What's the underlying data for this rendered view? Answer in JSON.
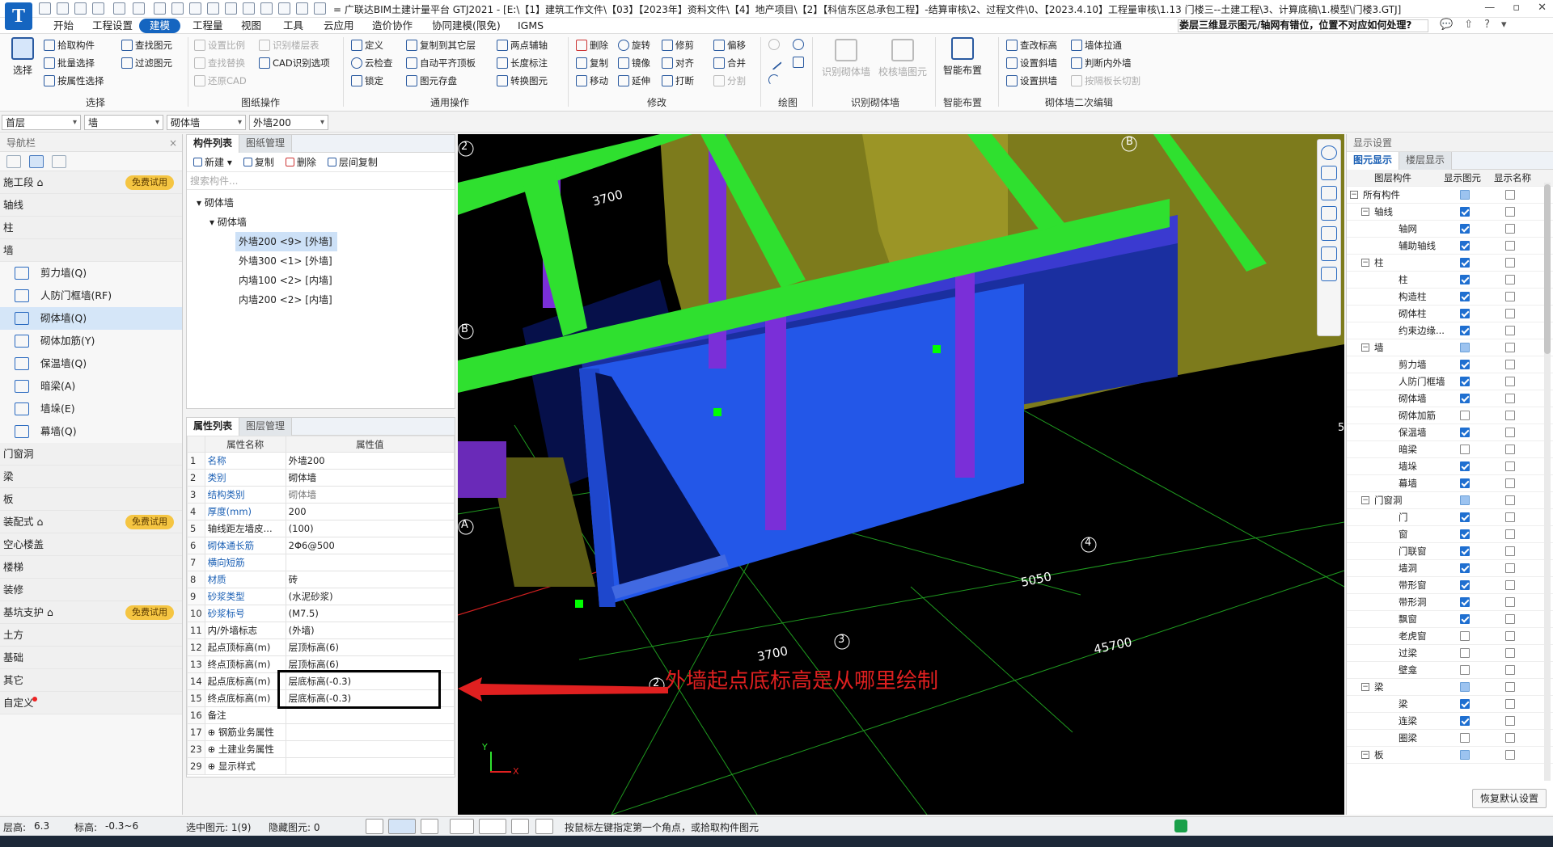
{
  "app": {
    "logo": "T",
    "title": "= 广联达BIM土建计量平台 GTJ2021 - [E:\\【1】建筑工作文件\\【03】【2023年】资料文件\\【4】地产项目\\【2】【科信东区总承包工程】-结算审核\\2、过程文件\\0、【2023.4.10】工程量审核\\1.13 门楼三--土建工程\\3、计算底稿\\1.模型\\门楼3.GTJ]",
    "window_controls": [
      "—",
      "▫",
      "✕"
    ]
  },
  "menu": {
    "items": [
      "开始",
      "工程设置",
      "建模",
      "工程量",
      "视图",
      "工具",
      "云应用",
      "造价协作",
      "协同建模(限免)",
      "IGMS"
    ],
    "active_index": 2,
    "help_question": "娄层三维显示图元/轴网有错位，位置不对应如何处理?",
    "right_icons": [
      "💬",
      "⇧",
      "?",
      "▾"
    ]
  },
  "ribbon": {
    "groups": [
      {
        "label": "选择",
        "big": "选择",
        "items": [
          "拾取构件",
          "批量选择",
          "按属性选择",
          "查找图元",
          "过滤图元"
        ]
      },
      {
        "label": "图纸操作",
        "items": [
          "设置比例",
          "查找替换",
          "还原CAD",
          "识别楼层表",
          "CAD识别选项"
        ]
      },
      {
        "label": "通用操作",
        "items": [
          "定义",
          "云检查",
          "锁定",
          "复制到其它层",
          "自动平齐顶板",
          "图元存盘",
          "两点辅轴",
          "长度标注",
          "转换图元"
        ]
      },
      {
        "label": "修改",
        "items": [
          "删除",
          "复制",
          "移动",
          "旋转",
          "镜像",
          "延伸",
          "修剪",
          "对齐",
          "打断",
          "偏移",
          "合并",
          "分割"
        ]
      },
      {
        "label": "绘图",
        "items": []
      },
      {
        "label": "识别砌体墙",
        "items": [
          "识别砌体墙",
          "校核墙图元"
        ]
      },
      {
        "label": "智能布置",
        "big": "智能布置",
        "items": []
      },
      {
        "label": "砌体墙二次编辑",
        "items": [
          "查改标高",
          "设置斜墙",
          "设置拱墙",
          "墙体拉通",
          "判断内外墙",
          "按隔板长切割"
        ]
      }
    ]
  },
  "selectors": [
    "首层",
    "墙",
    "砌体墙",
    "外墙200"
  ],
  "nav": {
    "title": "导航栏",
    "categories": [
      {
        "label": "施工段 ⌂",
        "badge": "免费试用"
      },
      {
        "label": "轴线"
      },
      {
        "label": "柱"
      },
      {
        "label": "墙"
      }
    ],
    "wall_items": [
      "剪力墙(Q)",
      "人防门框墙(RF)",
      "砌体墙(Q)",
      "砌体加筋(Y)",
      "保温墙(Q)",
      "暗梁(A)",
      "墙垛(E)",
      "幕墙(Q)"
    ],
    "selected_item": "砌体墙(Q)",
    "lower_categories": [
      {
        "label": "门窗洞"
      },
      {
        "label": "梁"
      },
      {
        "label": "板"
      },
      {
        "label": "装配式 ⌂",
        "badge": "免费试用"
      },
      {
        "label": "空心楼盖"
      },
      {
        "label": "楼梯"
      },
      {
        "label": "装修"
      },
      {
        "label": "基坑支护 ⌂",
        "badge": "免费试用"
      },
      {
        "label": "土方"
      },
      {
        "label": "基础"
      },
      {
        "label": "其它"
      },
      {
        "label": "自定义",
        "dot": true
      }
    ]
  },
  "component_list": {
    "tabs": [
      "构件列表",
      "图纸管理"
    ],
    "tools": [
      "新建 ▾",
      "复制",
      "删除",
      "层间复制"
    ],
    "search_placeholder": "搜索构件...",
    "tree": {
      "root": "砌体墙",
      "child": "砌体墙",
      "leaves": [
        "外墙200 <9> [外墙]",
        "外墙300 <1> [外墙]",
        "内墙100 <2> [内墙]",
        "内墙200 <2> [内墙]"
      ],
      "selected": 0
    }
  },
  "property_list": {
    "tabs": [
      "属性列表",
      "图层管理"
    ],
    "headers": [
      "属性名称",
      "属性值"
    ],
    "rows": [
      {
        "n": "1",
        "name": "名称",
        "value": "外墙200",
        "blue": true
      },
      {
        "n": "2",
        "name": "类别",
        "value": "砌体墙",
        "blue": true
      },
      {
        "n": "3",
        "name": "结构类别",
        "value": "砌体墙",
        "blue": true,
        "grey": true
      },
      {
        "n": "4",
        "name": "厚度(mm)",
        "value": "200",
        "blue": true
      },
      {
        "n": "5",
        "name": "轴线距左墙皮...",
        "value": "(100)"
      },
      {
        "n": "6",
        "name": "砌体通长筋",
        "value": "2Φ6@500",
        "blue": true
      },
      {
        "n": "7",
        "name": "横向短筋",
        "value": "",
        "blue": true
      },
      {
        "n": "8",
        "name": "材质",
        "value": "砖",
        "blue": true
      },
      {
        "n": "9",
        "name": "砂浆类型",
        "value": "(水泥砂浆)",
        "blue": true
      },
      {
        "n": "10",
        "name": "砂浆标号",
        "value": "(M7.5)",
        "blue": true
      },
      {
        "n": "11",
        "name": "内/外墙标志",
        "value": "(外墙)"
      },
      {
        "n": "12",
        "name": "起点顶标高(m)",
        "value": "层顶标高(6)"
      },
      {
        "n": "13",
        "name": "终点顶标高(m)",
        "value": "层顶标高(6)"
      },
      {
        "n": "14",
        "name": "起点底标高(m)",
        "value": "层底标高(-0.3)"
      },
      {
        "n": "15",
        "name": "终点底标高(m)",
        "value": "层底标高(-0.3)"
      },
      {
        "n": "16",
        "name": "备注",
        "value": ""
      },
      {
        "n": "17",
        "name": "⊕ 钢筋业务属性",
        "value": ""
      },
      {
        "n": "23",
        "name": "⊕ 土建业务属性",
        "value": ""
      },
      {
        "n": "29",
        "name": "⊕ 显示样式",
        "value": ""
      }
    ]
  },
  "viewport": {
    "annotation": "外墙起点底标高是从哪里绘制",
    "dims": [
      "3700",
      "3700",
      "5050",
      "45700"
    ],
    "axis_labels": [
      "2",
      "B",
      "B",
      "A",
      "2",
      "3",
      "4",
      "5"
    ],
    "axes_xyz": [
      "Y",
      "X"
    ]
  },
  "display": {
    "title": "显示设置",
    "tabs": [
      "图元显示",
      "楼层显示"
    ],
    "headers": [
      "图层构件",
      "显示图元",
      "显示名称"
    ],
    "rows": [
      {
        "label": "所有构件",
        "level": 0,
        "show": "part",
        "name": false,
        "exp": "−"
      },
      {
        "label": "轴线",
        "level": 1,
        "show": true,
        "name": false,
        "exp": "−"
      },
      {
        "label": "轴网",
        "level": 2,
        "show": true,
        "name": false
      },
      {
        "label": "辅助轴线",
        "level": 2,
        "show": true,
        "name": false
      },
      {
        "label": "柱",
        "level": 1,
        "show": true,
        "name": false,
        "exp": "−"
      },
      {
        "label": "柱",
        "level": 2,
        "show": true,
        "name": false
      },
      {
        "label": "构造柱",
        "level": 2,
        "show": true,
        "name": false
      },
      {
        "label": "砌体柱",
        "level": 2,
        "show": true,
        "name": false
      },
      {
        "label": "约束边缘...",
        "level": 2,
        "show": true,
        "name": false
      },
      {
        "label": "墙",
        "level": 1,
        "show": "part",
        "name": false,
        "exp": "−"
      },
      {
        "label": "剪力墙",
        "level": 2,
        "show": true,
        "name": false
      },
      {
        "label": "人防门框墙",
        "level": 2,
        "show": true,
        "name": false
      },
      {
        "label": "砌体墙",
        "level": 2,
        "show": true,
        "name": false
      },
      {
        "label": "砌体加筋",
        "level": 2,
        "show": false,
        "name": false
      },
      {
        "label": "保温墙",
        "level": 2,
        "show": true,
        "name": false
      },
      {
        "label": "暗梁",
        "level": 2,
        "show": false,
        "name": false
      },
      {
        "label": "墙垛",
        "level": 2,
        "show": true,
        "name": false
      },
      {
        "label": "幕墙",
        "level": 2,
        "show": true,
        "name": false
      },
      {
        "label": "门窗洞",
        "level": 1,
        "show": "part",
        "name": false,
        "exp": "−"
      },
      {
        "label": "门",
        "level": 2,
        "show": true,
        "name": false
      },
      {
        "label": "窗",
        "level": 2,
        "show": true,
        "name": false
      },
      {
        "label": "门联窗",
        "level": 2,
        "show": true,
        "name": false
      },
      {
        "label": "墙洞",
        "level": 2,
        "show": true,
        "name": false
      },
      {
        "label": "带形窗",
        "level": 2,
        "show": true,
        "name": false
      },
      {
        "label": "带形洞",
        "level": 2,
        "show": true,
        "name": false
      },
      {
        "label": "飘窗",
        "level": 2,
        "show": true,
        "name": false
      },
      {
        "label": "老虎窗",
        "level": 2,
        "show": false,
        "name": false
      },
      {
        "label": "过梁",
        "level": 2,
        "show": false,
        "name": false
      },
      {
        "label": "壁龛",
        "level": 2,
        "show": false,
        "name": false
      },
      {
        "label": "梁",
        "level": 1,
        "show": "part",
        "name": false,
        "exp": "−"
      },
      {
        "label": "梁",
        "level": 2,
        "show": true,
        "name": false
      },
      {
        "label": "连梁",
        "level": 2,
        "show": true,
        "name": false
      },
      {
        "label": "圈梁",
        "level": 2,
        "show": false,
        "name": false
      },
      {
        "label": "板",
        "level": 1,
        "show": "part",
        "name": false,
        "exp": "−"
      }
    ],
    "restore_button": "恢复默认设置"
  },
  "status": {
    "floor_height": "层高:",
    "floor_height_val": "6.3",
    "elevation": "标高:",
    "elevation_val": "-0.3~6",
    "selected": "选中图元: 1(9)",
    "hidden": "隐藏图元: 0",
    "hint": "按鼠标左键指定第一个角点，或拾取构件图元"
  },
  "colors": {
    "brand": "#1565c0",
    "beam": "#2fe02f",
    "wall": "#2357e8",
    "wall_dark": "#1a2fa0",
    "purple": "#7a2fd8",
    "olive": "#7f7d1e",
    "annotation": "#e02020"
  }
}
